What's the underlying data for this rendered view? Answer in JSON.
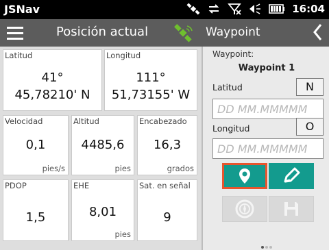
{
  "status_bar": {
    "app_name": "JSNav",
    "time": "16:04",
    "icons": [
      "satellite-icon",
      "sync-icon",
      "no-signal-icon",
      "volume-icon",
      "battery-icon"
    ]
  },
  "left_panel": {
    "header_title": "Posición actual",
    "tiles": {
      "latitude": {
        "label": "Latitud",
        "line1": "41°",
        "line2": "45,78210' N"
      },
      "longitude": {
        "label": "Longitud",
        "line1": "111°",
        "line2": "51,73155' W"
      },
      "speed": {
        "label": "Velocidad",
        "value": "0,1",
        "unit": "pies/s"
      },
      "altitude": {
        "label": "Altitud",
        "value": "4485,6",
        "unit": "pies"
      },
      "heading": {
        "label": "Encabezado",
        "value": "16,3",
        "unit": "grados"
      },
      "pdop": {
        "label": "PDOP",
        "value": "1,5",
        "unit": ""
      },
      "ehe": {
        "label": "EHE",
        "value": "8,01",
        "unit": "pies"
      },
      "satellites": {
        "label": "Sat. en señal",
        "value": "9",
        "unit": ""
      }
    }
  },
  "right_panel": {
    "header_title": "Waypoint",
    "waypoint_label": "Waypoint:",
    "waypoint_name": "Waypoint 1",
    "latitude_label": "Latitud",
    "latitude_dir": "N",
    "latitude_placeholder": "DD MM.MMMMM",
    "longitude_label": "Longitud",
    "longitude_dir": "O",
    "longitude_placeholder": "DD MM.MMMMM"
  },
  "colors": {
    "header_bg": "#5c5c5c",
    "accent_teal": "#139b8e",
    "selected_outline": "#e8552d",
    "satellite_green": "#6fbf2e"
  }
}
